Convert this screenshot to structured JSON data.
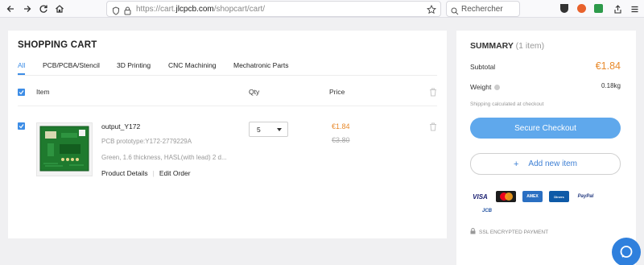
{
  "browser": {
    "url_prefix": "https://cart.",
    "url_domain": "jlcpcb.com",
    "url_path": "/shopcart/cart/",
    "search_placeholder": "Rechercher"
  },
  "cart": {
    "title": "SHOPPING CART",
    "tabs": [
      {
        "label": "All",
        "active": true
      },
      {
        "label": "PCB/PCBA/Stencil",
        "active": false
      },
      {
        "label": "3D Printing",
        "active": false
      },
      {
        "label": "CNC Machining",
        "active": false
      },
      {
        "label": "Mechatronic Parts",
        "active": false
      }
    ],
    "columns": {
      "item": "Item",
      "qty": "Qty",
      "price": "Price"
    },
    "items": [
      {
        "name": "output_Y172",
        "subtitle": "PCB prototype:Y172-2779229A",
        "description": "Green, 1.6 thickness, HASL(with lead) 2 d...",
        "qty": "5",
        "price": "€1.84",
        "old_price": "€3.80",
        "link_details": "Product Details",
        "link_edit": "Edit Order",
        "checked": true
      }
    ]
  },
  "summary": {
    "title": "SUMMARY",
    "count": "(1 item)",
    "subtotal_label": "Subtotal",
    "subtotal_value": "€1.84",
    "weight_label": "Weight",
    "weight_value": "0.18kg",
    "shipping_note": "Shipping calculated at checkout",
    "checkout_label": "Secure Checkout",
    "add_label": "Add new item",
    "payment_cards": [
      "VISA",
      "MasterCard",
      "AMEX",
      "Diners",
      "PayPal",
      "JCB"
    ],
    "ssl_label": "SSL ENCRYPTED PAYMENT"
  },
  "colors": {
    "accent": "#3d8de6",
    "price": "#e88a2c",
    "checkout_button": "#5fa8ec",
    "chat_button": "#2f80dd"
  },
  "icons": [
    "back-arrow-icon",
    "forward-arrow-icon",
    "reload-icon",
    "home-icon",
    "shield-icon",
    "lock-icon",
    "star-icon",
    "search-icon",
    "trash-icon",
    "check-icon",
    "info-icon",
    "plus-icon",
    "chat-icon"
  ]
}
